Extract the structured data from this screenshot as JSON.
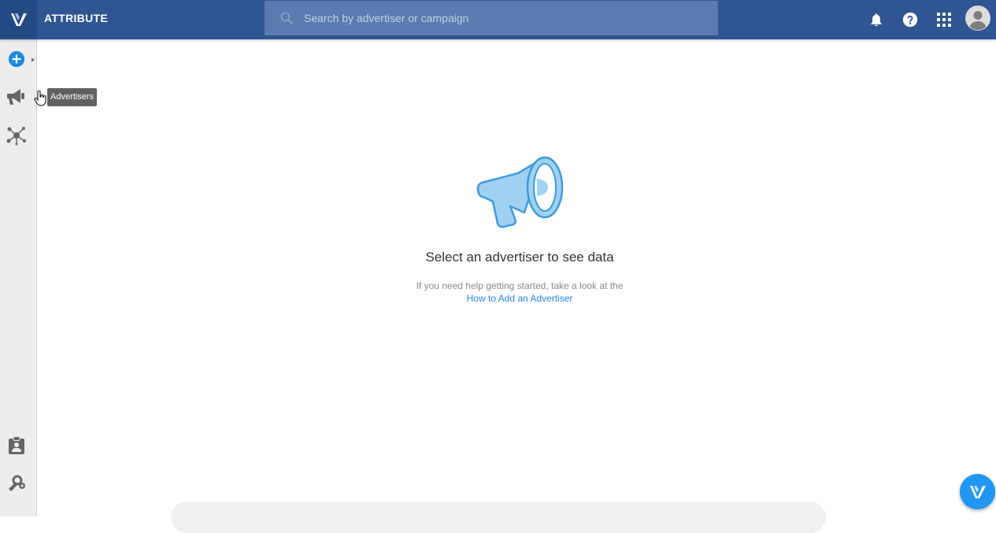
{
  "header": {
    "app_title": "ATTRIBUTE",
    "search_placeholder": "Search by advertiser or campaign",
    "icons": [
      "logo-icon",
      "bell-icon",
      "help-icon",
      "apps-grid-icon",
      "account-avatar-icon"
    ]
  },
  "sidebar": {
    "items": [
      {
        "name": "add",
        "icon": "plus-circle-icon"
      },
      {
        "name": "advertisers",
        "icon": "megaphone-icon",
        "tooltip": "Advertisers"
      },
      {
        "name": "network",
        "icon": "network-icon"
      },
      {
        "name": "contacts",
        "icon": "clipboard-account-icon"
      },
      {
        "name": "tools",
        "icon": "tools-icon"
      }
    ]
  },
  "tooltip": {
    "label": "Advertisers"
  },
  "empty_state": {
    "title": "Select an advertiser to see data",
    "help_text": "If you need help getting started, take a look at the",
    "link_text": "How to Add an Advertiser",
    "illustration": "megaphone-illustration"
  },
  "colors": {
    "header": "#2f5592",
    "logo_box": "#244a85",
    "accent": "#1e88e5",
    "illustration_fill": "#9fd1f2",
    "illustration_stroke": "#3a9be0"
  }
}
